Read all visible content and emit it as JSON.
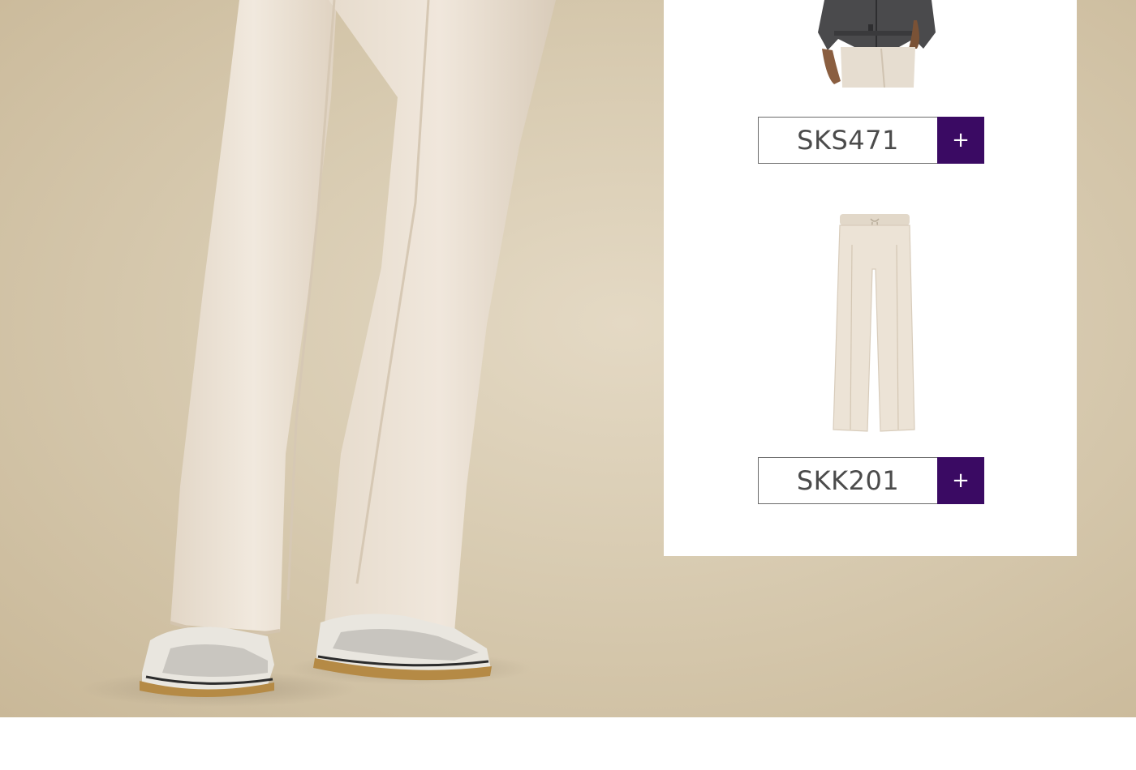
{
  "products": [
    {
      "sku": "SKS471",
      "add_label": "+",
      "image_icon": "jacket-outfit-thumbnail"
    },
    {
      "sku": "SKK201",
      "add_label": "+",
      "image_icon": "trousers-thumbnail"
    }
  ],
  "colors": {
    "accent": "#3a0a63",
    "backdrop": "#d8cbb1",
    "trousers": "#ece2d4"
  }
}
